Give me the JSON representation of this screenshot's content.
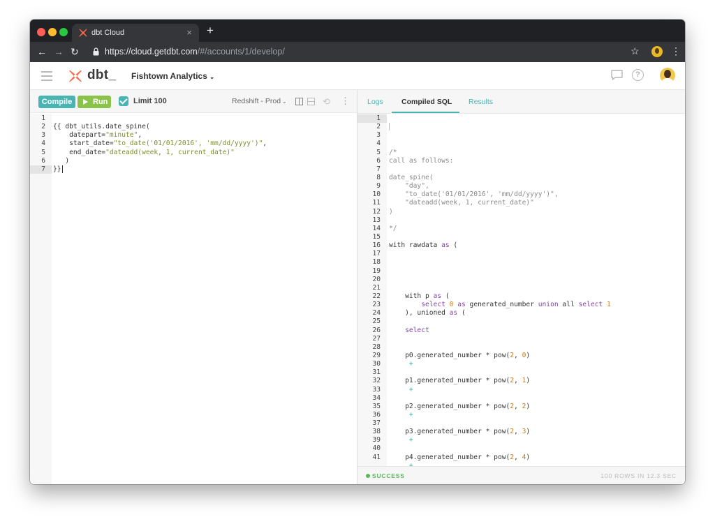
{
  "browser": {
    "tab_title": "dbt Cloud",
    "tab_close": "×",
    "new_tab": "+",
    "back": "←",
    "forward": "→",
    "reload": "↻",
    "url_host": "https://cloud.getdbt.com",
    "url_path": "/#/accounts/1/develop/",
    "star": "☆",
    "menu": "⋮"
  },
  "header": {
    "logo_text": "dbt_",
    "org_name": "Fishtown Analytics",
    "org_chevron": "⌄",
    "help": "?"
  },
  "toolbar": {
    "compile_label": "Compile",
    "run_label": "Run",
    "limit_label": "Limit 100",
    "target_label": "Redshift - Prod",
    "target_chevron": "⌄",
    "history_icon": "⟲",
    "more_icon": "⋮"
  },
  "editor": {
    "line_numbers": [
      "1",
      "2",
      "3",
      "4",
      "5",
      "6",
      "7"
    ],
    "current_line": 7
  },
  "results": {
    "tabs": [
      "Logs",
      "Compiled SQL",
      "Results"
    ],
    "active_tab": "Compiled SQL",
    "line_numbers": [
      "1",
      "2",
      "3",
      "4",
      "5",
      "6",
      "7",
      "8",
      "9",
      "10",
      "11",
      "12",
      "13",
      "14",
      "15",
      "16",
      "17",
      "18",
      "19",
      "20",
      "21",
      "22",
      "23",
      "24",
      "25",
      "26",
      "27",
      "28",
      "29",
      "30",
      "31",
      "32",
      "33",
      "34",
      "35",
      "36",
      "37",
      "38",
      "39",
      "40",
      "41"
    ],
    "current_line": 1,
    "status": "SUCCESS",
    "meta": "100 ROWS IN 12.3 SEC"
  },
  "colors": {
    "accent": "#49b5b3",
    "run": "#8bc34a",
    "success": "#5cb85c",
    "string": "#7b8f2b",
    "keyword": "#8044a6",
    "number": "#c97a1b"
  }
}
